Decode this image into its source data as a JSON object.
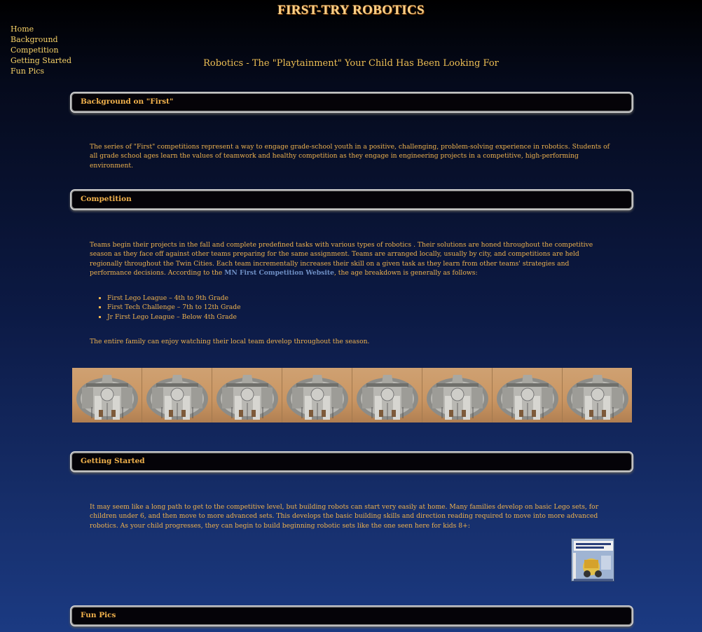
{
  "site": {
    "title": "FIRST-TRY ROBOTICS"
  },
  "nav": {
    "items": [
      {
        "label": "Home"
      },
      {
        "label": "Background"
      },
      {
        "label": "Competition"
      },
      {
        "label": "Getting Started"
      },
      {
        "label": "Fun Pics"
      }
    ]
  },
  "tagline": "Robotics - The \"Playtainment\" Your Child Has Been Looking For",
  "sections": {
    "background": {
      "heading": "Background on \"First\"",
      "body": "The series of \"First\" competitions represent a way to engage grade-school youth in a positive, challenging, problem-solving experience in robotics. Students of all grade school ages learn the values of teamwork and healthy competition as they engage in engineering projects in a competitive, high-performing environment."
    },
    "competition": {
      "heading": "Competition",
      "body_before_link": "Teams begin their projects in the fall and complete predefined tasks with various types of robotics . Their solutions are honed throughout the competitive season as they face off against other teams preparing for the same assignment. Teams are arranged locally, usually by city, and competitions are held regionally throughout the Twin Cities. Each team incrementally increases their skill on a given task as they learn from other teams' strategies and performance decisions. According to the ",
      "link_text": "MN First Competition Website",
      "body_after_link": ", the age breakdown is generally as follows:",
      "bullets": [
        "First Lego League – 4th to 9th Grade",
        "First Tech Challenge – 7th to 12th Grade",
        "Jr First Lego League – Below 4th Grade"
      ],
      "closing": "The entire family can enjoy watching their local team develop throughout the season."
    },
    "getting_started": {
      "heading": "Getting Started",
      "body": "It may seem like a long path to get to the competitive level, but building robots can start very easily at home. Many families develop on basic Lego sets, for children under 6, and then move to more advanced sets. This develops the basic building skills and direction reading required to move into more advanced robotics. As your child progresses, they can begin to build beginning robotic sets like the one seen here for kids 8+:"
    },
    "fun_pics": {
      "heading": "Fun Pics"
    }
  },
  "colors": {
    "text": "#eeb24e",
    "link": "#6f8fc4",
    "bar_bg": "#050308",
    "page_top": "#000000",
    "page_bottom": "#1b3a82"
  },
  "images": {
    "strip_tile_count": 8,
    "strip_subject": "lego-spaceship-photo",
    "kit_box": "robotic-kit-box-photo"
  }
}
